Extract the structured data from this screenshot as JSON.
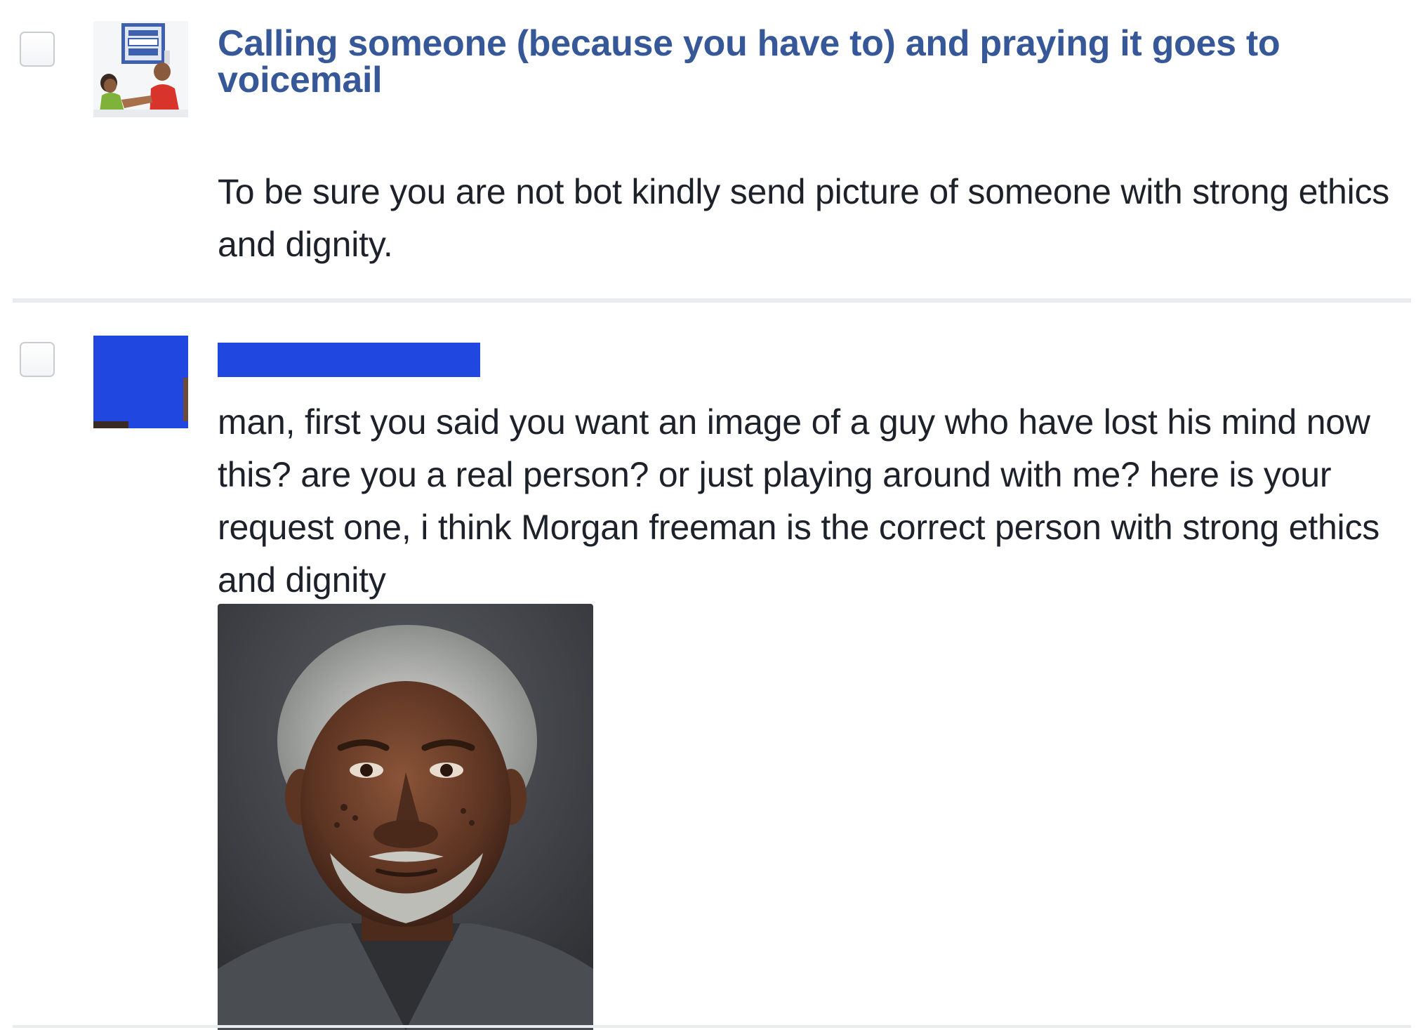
{
  "thread": {
    "title": "Calling someone (because you have to) and praying it goes to voicemail",
    "title_color": "#365899",
    "accent_redaction_color": "#2048e0"
  },
  "messages": [
    {
      "avatar_icon": "voicemail-clipart-avatar",
      "text": "To be sure you are not bot kindly send picture of someone with strong ethics and dignity."
    },
    {
      "sender_name_redacted": true,
      "avatar_icon": "redacted-avatar",
      "text": "man, first you said you want an image of a guy who have lost his mind now this? are you a real person? or just playing around with me? here is your request one, i think Morgan freeman is the correct person with strong ethics and dignity",
      "attachment_icon": "portrait-photo-attachment"
    }
  ]
}
